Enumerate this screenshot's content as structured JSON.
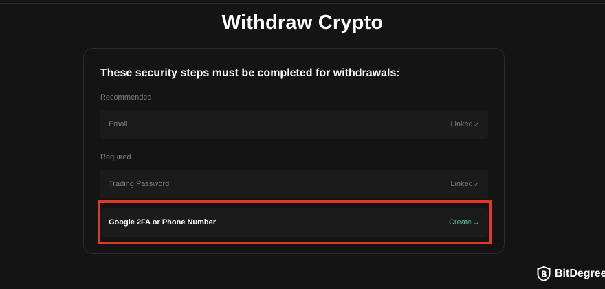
{
  "page": {
    "title": "Withdraw Crypto"
  },
  "security": {
    "heading": "These security steps must be completed for withdrawals:",
    "sections": [
      {
        "label": "Recommended",
        "items": [
          {
            "label": "Email",
            "status": "Linked",
            "status_icon": "check-icon"
          }
        ]
      },
      {
        "label": "Required",
        "items": [
          {
            "label": "Trading Password",
            "status": "Linked",
            "status_icon": "check-icon"
          },
          {
            "label": "Google 2FA or Phone Number",
            "status": "Create",
            "status_icon": "arrow-right-icon"
          }
        ]
      }
    ]
  },
  "glyphs": {
    "check": "✓",
    "arrow": "→"
  },
  "colors": {
    "background": "#141414",
    "row_background": "#1b1b1b",
    "accent_green": "#4fc08a",
    "highlight_red": "#e03a26",
    "muted_text": "#7a7a7a"
  },
  "watermark": {
    "brand": "BitDegree",
    "logo_icon": "bitdegree-shield-icon"
  }
}
